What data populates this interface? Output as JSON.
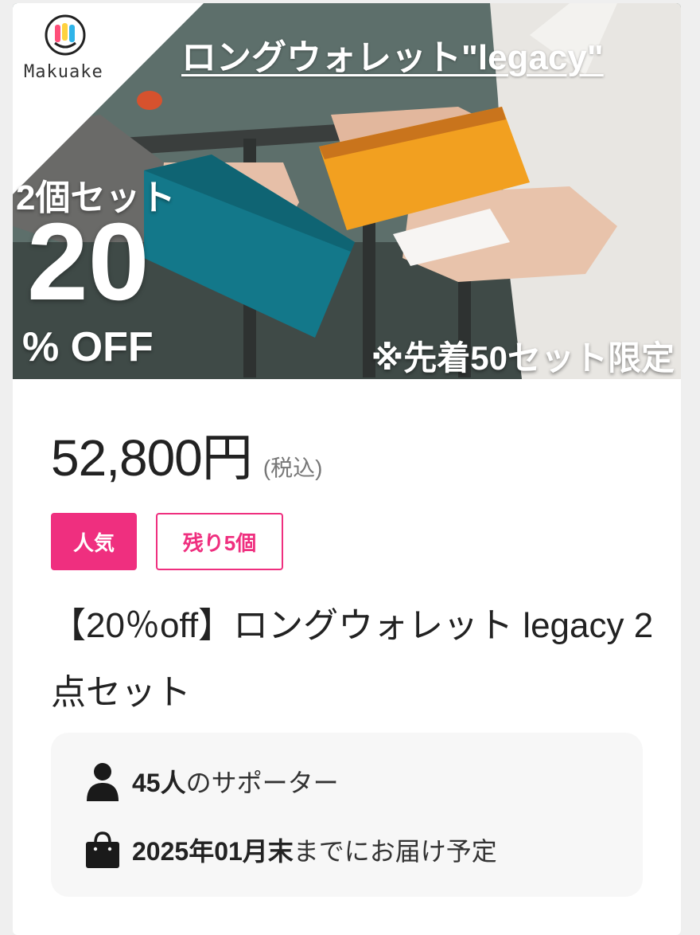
{
  "hero": {
    "brand": "Makuake",
    "title": "ロングウォレット\"legacy\"",
    "set_label": "2個セット",
    "discount_number": "20",
    "discount_suffix": "% OFF",
    "limit_note": "※先着50セット限定",
    "brand_colors": [
      "#ff4f7a",
      "#ffd23f",
      "#2fb4e9",
      "#8b5cf6"
    ]
  },
  "product": {
    "price": "52,800円",
    "tax_note": "(税込)",
    "badge_popular": "人気",
    "badge_remaining": "残り5個",
    "title": "【20％off】ロングウォレット legacy 2点セット"
  },
  "info": {
    "supporters_count": "45人",
    "supporters_suffix": "のサポーター",
    "delivery_date": "2025年01月末",
    "delivery_suffix": "までにお届け予定",
    "supporter_icon": "person-icon",
    "delivery_icon": "shopping-bag-icon"
  },
  "colors": {
    "accent": "#ef2f7f",
    "text": "#222222",
    "muted": "#777777",
    "info_bg": "#f7f7f7"
  }
}
